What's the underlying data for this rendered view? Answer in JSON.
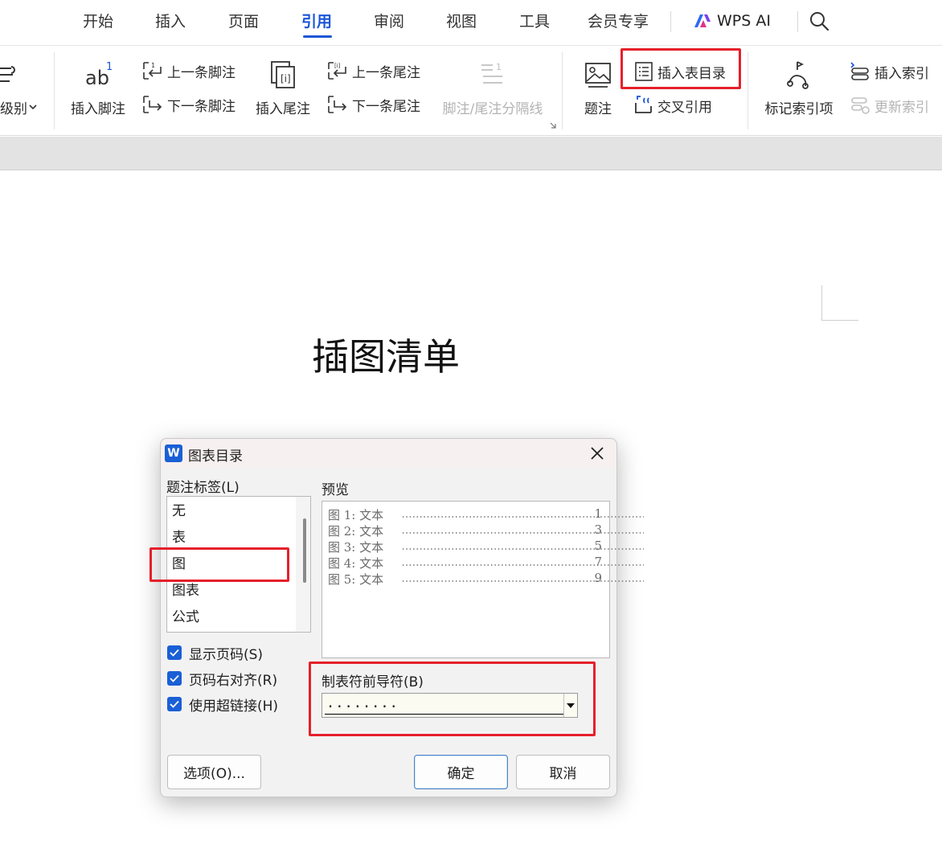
{
  "menu": {
    "tabs": [
      "开始",
      "插入",
      "页面",
      "引用",
      "审阅",
      "视图",
      "工具",
      "会员专享"
    ],
    "active_tab": "引用",
    "wps_ai": "WPS AI"
  },
  "ribbon": {
    "level_partial": "级别",
    "insert_footnote": "插入脚注",
    "prev_footnote": "上一条脚注",
    "next_footnote": "下一条脚注",
    "insert_endnote": "插入尾注",
    "prev_endnote": "上一条尾注",
    "next_endnote": "下一条尾注",
    "separator": "脚注/尾注分隔线",
    "caption": "题注",
    "insert_toc_table": "插入表目录",
    "cross_ref": "交叉引用",
    "mark_index": "标记索引项",
    "insert_index": "插入索引",
    "update_index": "更新索引"
  },
  "document": {
    "title": "插图清单"
  },
  "dialog": {
    "title": "图表目录",
    "caption_label": "题注标签(L)",
    "caption_items": [
      "无",
      "表",
      "图",
      "图表",
      "公式"
    ],
    "selected_caption": "图",
    "preview_label": "预览",
    "preview_lines": [
      {
        "text": "图 1: 文本",
        "page": "1"
      },
      {
        "text": "图 2: 文本",
        "page": "3"
      },
      {
        "text": "图 3: 文本",
        "page": "5"
      },
      {
        "text": "图 4: 文本",
        "page": "7"
      },
      {
        "text": "图 5: 文本",
        "page": "9"
      }
    ],
    "show_page_numbers": "显示页码(S)",
    "right_align": "页码右对齐(R)",
    "use_hyperlinks": "使用超链接(H)",
    "checks": {
      "show_page_numbers": true,
      "right_align": true,
      "use_hyperlinks": true
    },
    "tab_leader_label": "制表符前导符(B)",
    "tab_leader_value": "........",
    "options_button": "选项(O)...",
    "ok_button": "确定",
    "cancel_button": "取消"
  },
  "colors": {
    "accent": "#1a56d6",
    "highlight": "#e5202a",
    "checkbox": "#1a5fd6"
  }
}
